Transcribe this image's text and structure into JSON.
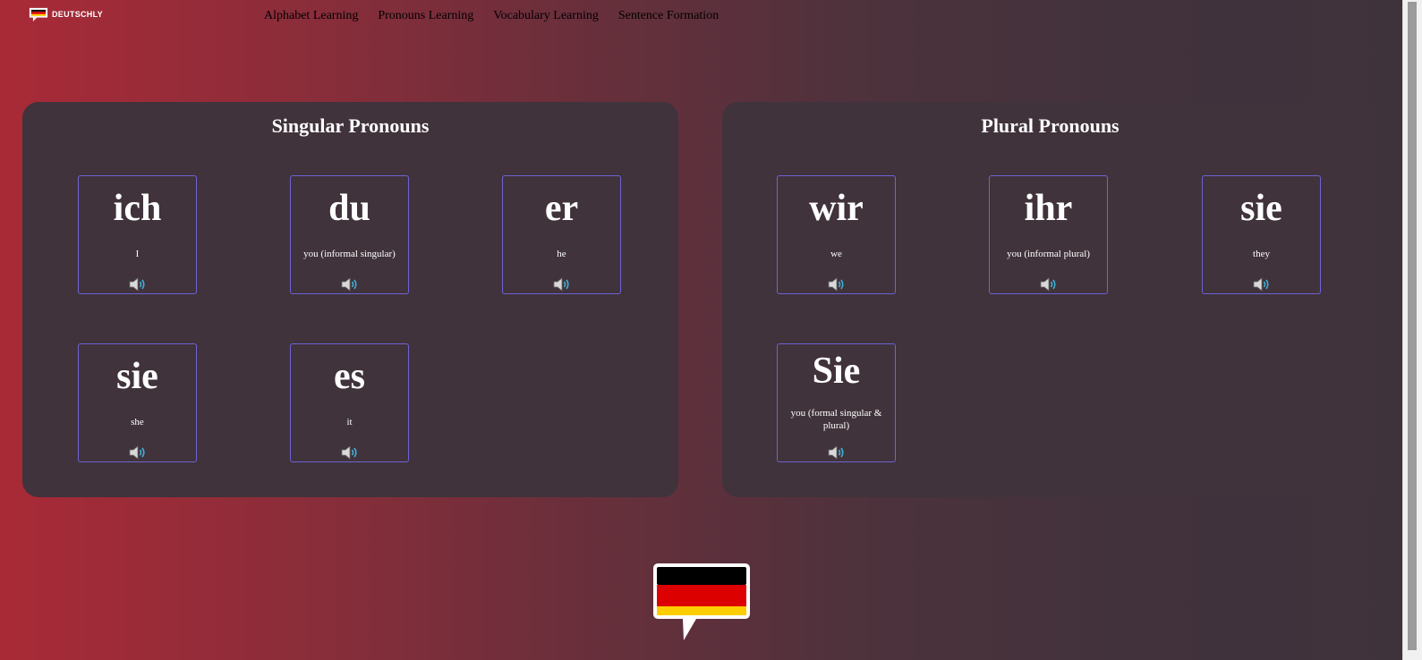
{
  "brand": {
    "name": "DEUTSCHLY"
  },
  "nav": {
    "items": [
      {
        "label": "Alphabet Learning"
      },
      {
        "label": "Pronouns Learning"
      },
      {
        "label": "Vocabulary Learning"
      },
      {
        "label": "Sentence Formation"
      }
    ]
  },
  "singular": {
    "title": "Singular Pronouns",
    "cards": [
      {
        "word": "ich",
        "meaning": "I",
        "icon": "speaker-icon"
      },
      {
        "word": "du",
        "meaning": "you (informal singular)",
        "icon": "speaker-icon"
      },
      {
        "word": "er",
        "meaning": "he",
        "icon": "speaker-icon"
      },
      {
        "word": "sie",
        "meaning": "she",
        "icon": "speaker-icon"
      },
      {
        "word": "es",
        "meaning": "it",
        "icon": "speaker-icon"
      }
    ]
  },
  "plural": {
    "title": "Plural Pronouns",
    "cards": [
      {
        "word": "wir",
        "meaning": "we",
        "icon": "speaker-icon"
      },
      {
        "word": "ihr",
        "meaning": "you (informal plural)",
        "icon": "speaker-icon"
      },
      {
        "word": "sie",
        "meaning": "they",
        "icon": "speaker-icon"
      },
      {
        "word": "Sie",
        "meaning": "you (formal singular & plural)",
        "icon": "speaker-icon"
      }
    ]
  },
  "colors": {
    "card_border": "#6e63d6",
    "panel_bg": "#40333b",
    "gradient_start": "#a92a37",
    "gradient_end": "#3f333b",
    "flag_black": "#000000",
    "flag_red": "#dd0000",
    "flag_gold": "#ffce00"
  }
}
